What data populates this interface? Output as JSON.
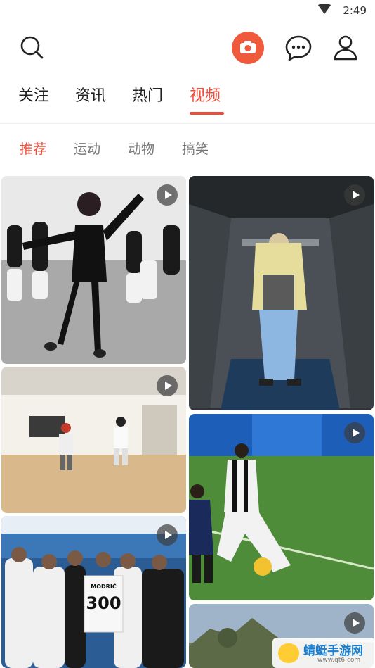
{
  "status_bar": {
    "time": "2:49",
    "wifi_icon": "wifi-icon"
  },
  "header": {
    "search_icon": "search-icon",
    "camera_icon": "camera-icon",
    "message_icon": "chat-bubble-icon",
    "profile_icon": "user-icon",
    "accent_color": "#ef4c3a"
  },
  "tabs": [
    {
      "label": "关注"
    },
    {
      "label": "资讯"
    },
    {
      "label": "热门"
    },
    {
      "label": "视频",
      "active": true
    }
  ],
  "subtabs": [
    {
      "label": "推荐",
      "active": true
    },
    {
      "label": "运动"
    },
    {
      "label": "动物"
    },
    {
      "label": "搞笑"
    }
  ],
  "video_cards": [
    {
      "kind": "dance-group",
      "play_icon": "play-icon"
    },
    {
      "kind": "van-interior",
      "play_icon": "play-icon"
    },
    {
      "kind": "dance-studio",
      "play_icon": "play-icon"
    },
    {
      "kind": "soccer-match",
      "play_icon": "play-icon"
    },
    {
      "kind": "locker-room",
      "jersey_name": "MODRIĆ",
      "jersey_number": "300",
      "play_icon": "play-icon"
    },
    {
      "kind": "landscape",
      "play_icon": "play-icon"
    }
  ],
  "watermark": {
    "title": "蜻蜓手游网",
    "sub": "www.qt6.com"
  }
}
